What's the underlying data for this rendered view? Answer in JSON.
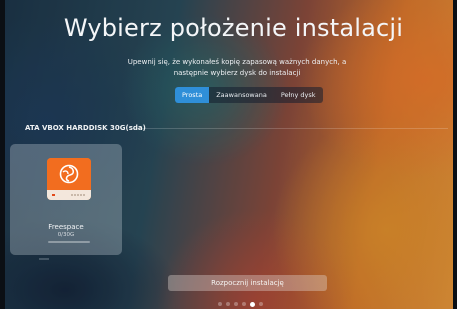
{
  "header": {
    "title": "Wybierz położenie instalacji",
    "subtitle": "Upewnij się, że wykonałeś kopię zapasową ważnych danych, a następnie wybierz dysk do instalacji"
  },
  "modes": {
    "tabs": [
      {
        "label": "Prosta",
        "active": true
      },
      {
        "label": "Zaawansowana",
        "active": false
      },
      {
        "label": "Pełny dysk",
        "active": false
      }
    ]
  },
  "disk": {
    "label": "ATA VBOX HARDDISK 30G(sda)"
  },
  "partitions": [
    {
      "name": "Freespace",
      "size": "0/30G",
      "icon": "deepin-disk-icon",
      "usage_fraction": 0.0
    }
  ],
  "footer": {
    "start_label": "Rozpocznij instalację",
    "steps_total": 6,
    "steps_current": 5
  },
  "colors": {
    "accent": "#2f8fd8",
    "disk_icon": "#f26d1f"
  }
}
